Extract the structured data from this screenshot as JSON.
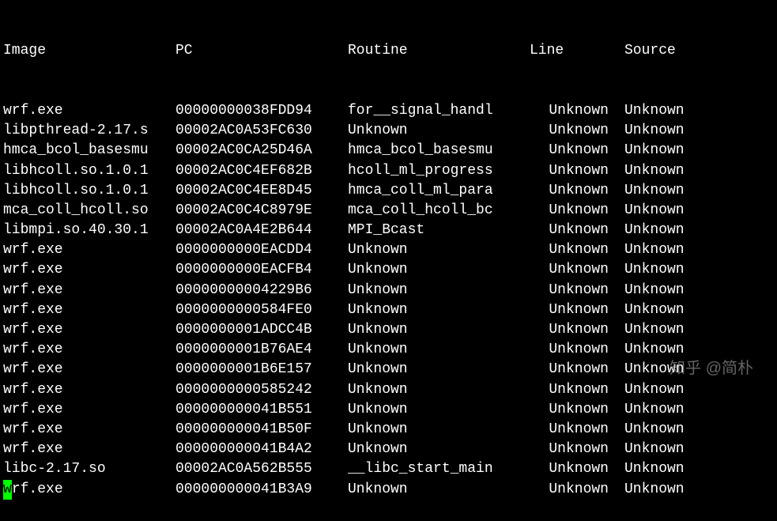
{
  "headers": {
    "image": "Image",
    "pc": "PC",
    "routine": "Routine",
    "line": "Line",
    "source": "Source"
  },
  "rows": [
    {
      "image": "wrf.exe",
      "pc": "00000000038FDD94",
      "routine": "for__signal_handl",
      "line": "Unknown",
      "source": "Unknown"
    },
    {
      "image": "libpthread-2.17.s",
      "pc": "00002AC0A53FC630",
      "routine": "Unknown",
      "line": "Unknown",
      "source": "Unknown"
    },
    {
      "image": "hmca_bcol_basesmu",
      "pc": "00002AC0CA25D46A",
      "routine": "hmca_bcol_basesmu",
      "line": "Unknown",
      "source": "Unknown"
    },
    {
      "image": "libhcoll.so.1.0.1",
      "pc": "00002AC0C4EF682B",
      "routine": "hcoll_ml_progress",
      "line": "Unknown",
      "source": "Unknown"
    },
    {
      "image": "libhcoll.so.1.0.1",
      "pc": "00002AC0C4EE8D45",
      "routine": "hmca_coll_ml_para",
      "line": "Unknown",
      "source": "Unknown"
    },
    {
      "image": "mca_coll_hcoll.so",
      "pc": "00002AC0C4C8979E",
      "routine": "mca_coll_hcoll_bc",
      "line": "Unknown",
      "source": "Unknown"
    },
    {
      "image": "libmpi.so.40.30.1",
      "pc": "00002AC0A4E2B644",
      "routine": "MPI_Bcast",
      "line": "Unknown",
      "source": "Unknown"
    },
    {
      "image": "wrf.exe",
      "pc": "0000000000EACDD4",
      "routine": "Unknown",
      "line": "Unknown",
      "source": "Unknown"
    },
    {
      "image": "wrf.exe",
      "pc": "0000000000EACFB4",
      "routine": "Unknown",
      "line": "Unknown",
      "source": "Unknown"
    },
    {
      "image": "wrf.exe",
      "pc": "00000000004229B6",
      "routine": "Unknown",
      "line": "Unknown",
      "source": "Unknown"
    },
    {
      "image": "wrf.exe",
      "pc": "0000000000584FE0",
      "routine": "Unknown",
      "line": "Unknown",
      "source": "Unknown"
    },
    {
      "image": "wrf.exe",
      "pc": "0000000001ADCC4B",
      "routine": "Unknown",
      "line": "Unknown",
      "source": "Unknown"
    },
    {
      "image": "wrf.exe",
      "pc": "0000000001B76AE4",
      "routine": "Unknown",
      "line": "Unknown",
      "source": "Unknown"
    },
    {
      "image": "wrf.exe",
      "pc": "0000000001B6E157",
      "routine": "Unknown",
      "line": "Unknown",
      "source": "Unknown"
    },
    {
      "image": "wrf.exe",
      "pc": "0000000000585242",
      "routine": "Unknown",
      "line": "Unknown",
      "source": "Unknown"
    },
    {
      "image": "wrf.exe",
      "pc": "000000000041B551",
      "routine": "Unknown",
      "line": "Unknown",
      "source": "Unknown"
    },
    {
      "image": "wrf.exe",
      "pc": "000000000041B50F",
      "routine": "Unknown",
      "line": "Unknown",
      "source": "Unknown"
    },
    {
      "image": "wrf.exe",
      "pc": "000000000041B4A2",
      "routine": "Unknown",
      "line": "Unknown",
      "source": "Unknown"
    },
    {
      "image": "libc-2.17.so",
      "pc": "00002AC0A562B555",
      "routine": "__libc_start_main",
      "line": "Unknown",
      "source": "Unknown"
    },
    {
      "image": "wrf.exe",
      "pc": "000000000041B3A9",
      "routine": "Unknown",
      "line": "Unknown",
      "source": "Unknown"
    }
  ],
  "watermark": "知乎 @简朴"
}
